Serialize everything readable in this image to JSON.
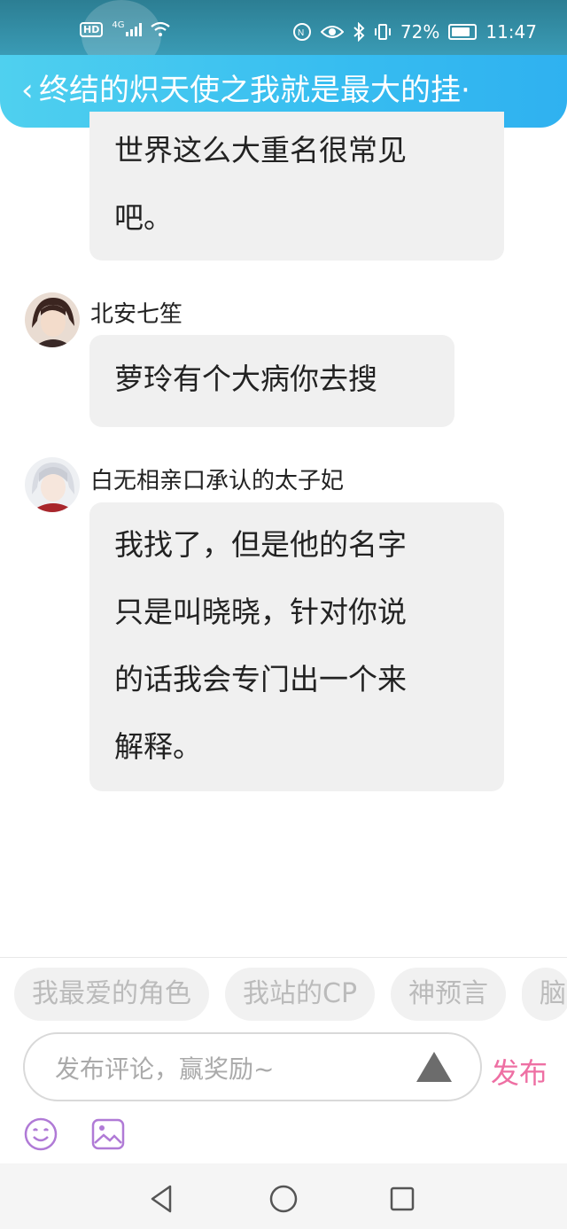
{
  "status_bar": {
    "hd": "HD",
    "network": "4G",
    "battery": "72%",
    "time": "11:47"
  },
  "header": {
    "back": "‹",
    "title": "终结的炽天使之我就是最大的挂·"
  },
  "messages": [
    {
      "text_lines": [
        "世界这么大重名很常见",
        "吧。"
      ]
    },
    {
      "author": "北安七笙",
      "text_lines": [
        "萝玲有个大病你去搜"
      ]
    },
    {
      "author": "白无相亲口承认的太子妃",
      "text_lines": [
        "我找了，但是他的名字",
        "只是叫晓晓，针对你说",
        "的话我会专门出一个来",
        "解释。"
      ]
    }
  ],
  "chips": [
    "我最爱的角色",
    "我站的CP",
    "神预言",
    "脑"
  ],
  "input": {
    "placeholder": "发布评论，赢奖励~"
  },
  "publish_label": "发布",
  "icons": {
    "emoji": "emoji-icon",
    "image": "image-icon",
    "send": "send-triangle-icon"
  },
  "colors": {
    "header_start": "#4fd0ef",
    "header_end": "#2fb1f0",
    "publish": "#ee6fa3",
    "tool_icons": "#b07ad6"
  }
}
